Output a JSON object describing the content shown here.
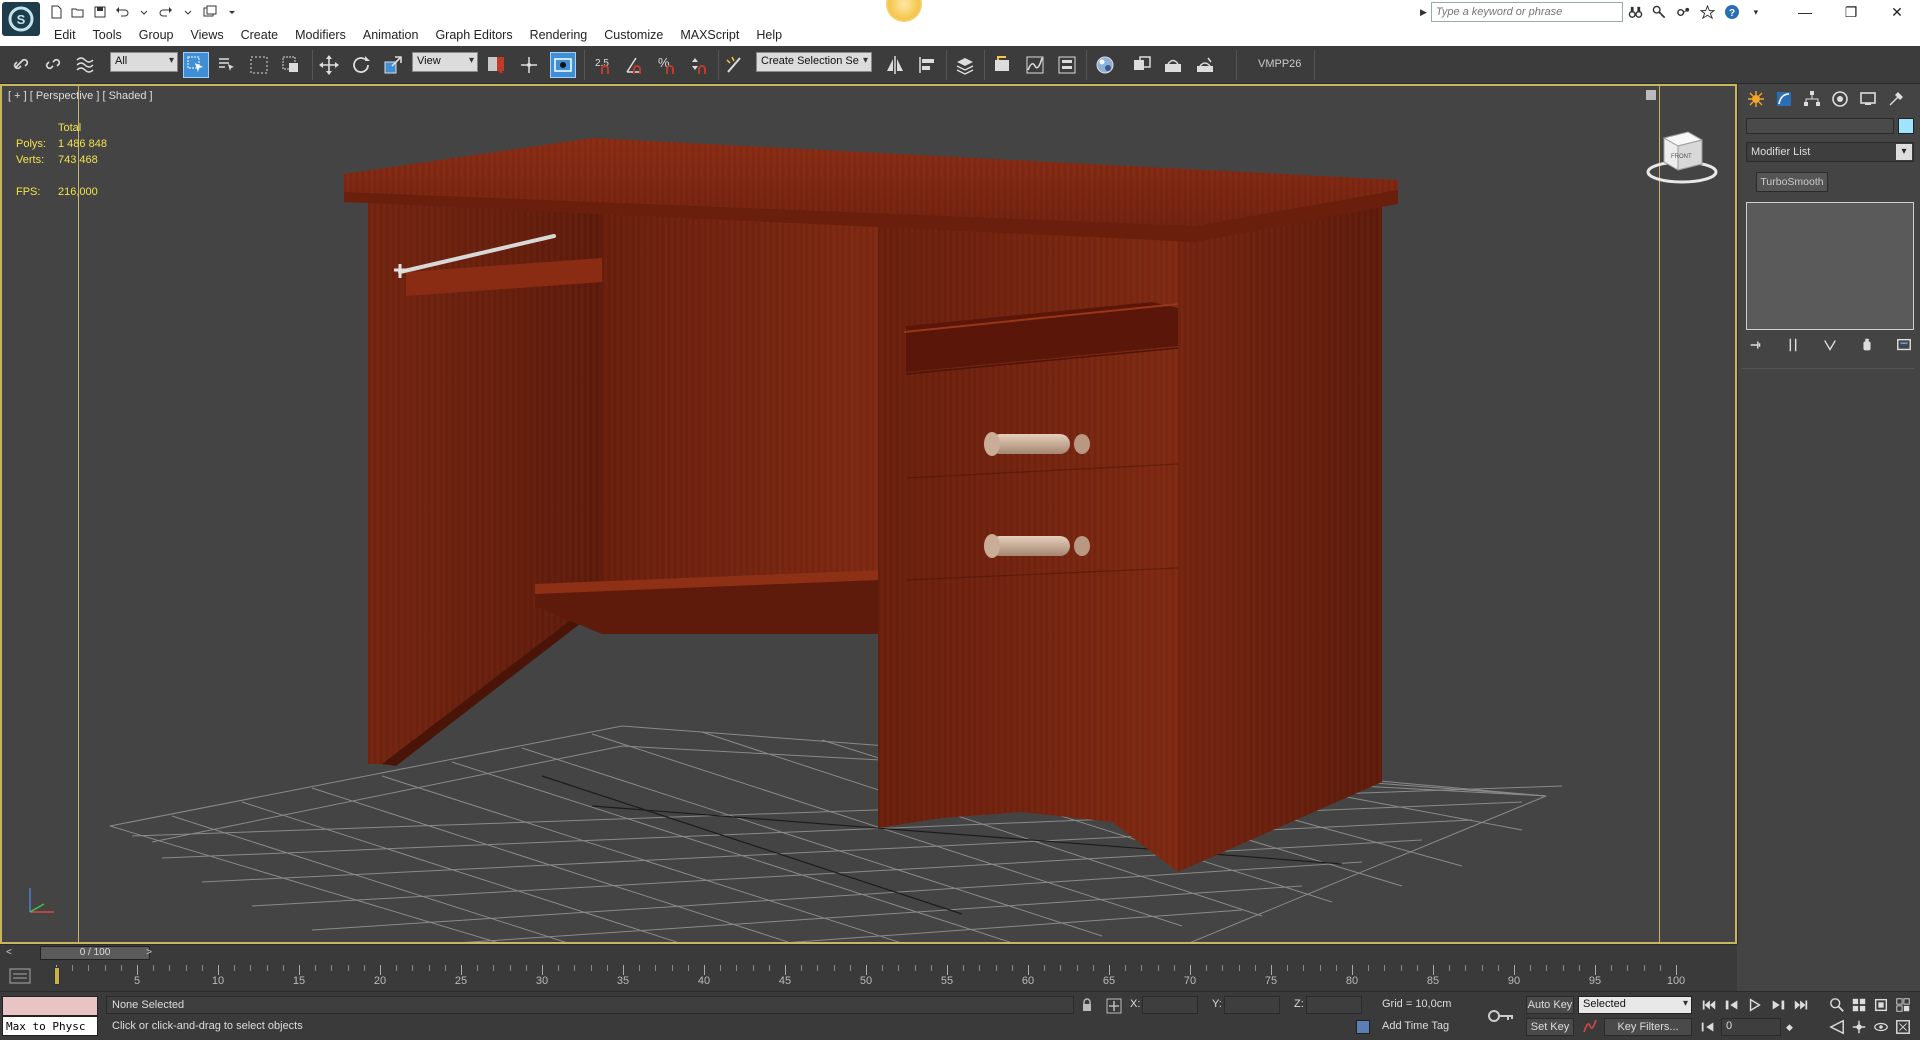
{
  "menu": [
    "Edit",
    "Tools",
    "Group",
    "Views",
    "Create",
    "Modifiers",
    "Animation",
    "Graph Editors",
    "Rendering",
    "Customize",
    "MAXScript",
    "Help"
  ],
  "search": {
    "placeholder": "Type a keyword or phrase"
  },
  "toolbar": {
    "filter_value": "All",
    "refcoord_value": "View",
    "snap_value": "2.5",
    "selection_set_value": "Create Selection Se",
    "vray_label": "VMPP26"
  },
  "viewport": {
    "label": "[ + ] [ Perspective ] [ Shaded ]",
    "stats": {
      "total_label": "Total",
      "polys_label": "Polys:",
      "polys_value": "1 486 848",
      "verts_label": "Verts:",
      "verts_value": "743 468",
      "fps_label": "FPS:",
      "fps_value": "216,000"
    },
    "viewcube_label": "FRONT"
  },
  "command_panel": {
    "modifier_list": "Modifier List",
    "stack_button": "TurboSmooth",
    "object_color": "#9fe4ff"
  },
  "timeline": {
    "slider_label": "0 / 100",
    "ticks": [
      "5",
      "10",
      "15",
      "20",
      "25",
      "30",
      "35",
      "40",
      "45",
      "50",
      "55",
      "60",
      "65",
      "70",
      "75",
      "80",
      "85",
      "90",
      "95",
      "100"
    ]
  },
  "status": {
    "maxscript_input": "Max to Physc",
    "selection_text": "None Selected",
    "prompt_text": "Click or click-and-drag to select objects",
    "x_label": "X:",
    "y_label": "Y:",
    "z_label": "Z:",
    "grid_text": "Grid = 10,0cm",
    "add_time_tag": "Add Time Tag",
    "auto_key": "Auto Key",
    "set_key": "Set Key",
    "selected_value": "Selected",
    "key_filters": "Key Filters...",
    "frame_value": "0"
  },
  "colors": {
    "accent": "#3f8fd6",
    "viewport_border": "#c8b560",
    "stats_text": "#f2e24c",
    "wood": "#7a2412"
  }
}
